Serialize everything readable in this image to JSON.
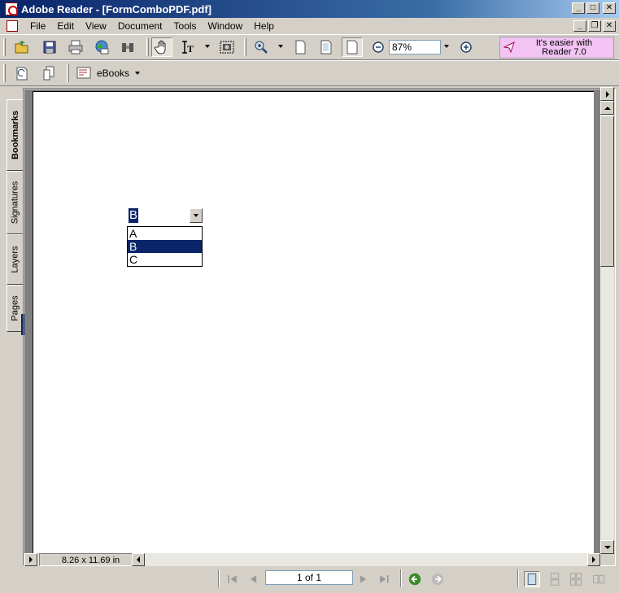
{
  "window": {
    "title": "Adobe Reader - [FormComboPDF.pdf]"
  },
  "menu": [
    "File",
    "Edit",
    "View",
    "Document",
    "Tools",
    "Window",
    "Help"
  ],
  "toolbar": {
    "zoom": "87%",
    "ebooks_label": "eBooks"
  },
  "promo": {
    "line1": "It's easier with",
    "line2": "Reader 7.0"
  },
  "sidebar_tabs": [
    "Bookmarks",
    "Signatures",
    "Layers",
    "Pages"
  ],
  "document": {
    "combo_value": "B",
    "options": [
      "A",
      "B",
      "C"
    ],
    "selected_index": 1
  },
  "status": {
    "page_size": "8.26 x 11.69 in",
    "page_indicator": "1 of 1"
  },
  "colors": {
    "selection": "#0a246a",
    "promo_bg": "#f3c3f3"
  }
}
